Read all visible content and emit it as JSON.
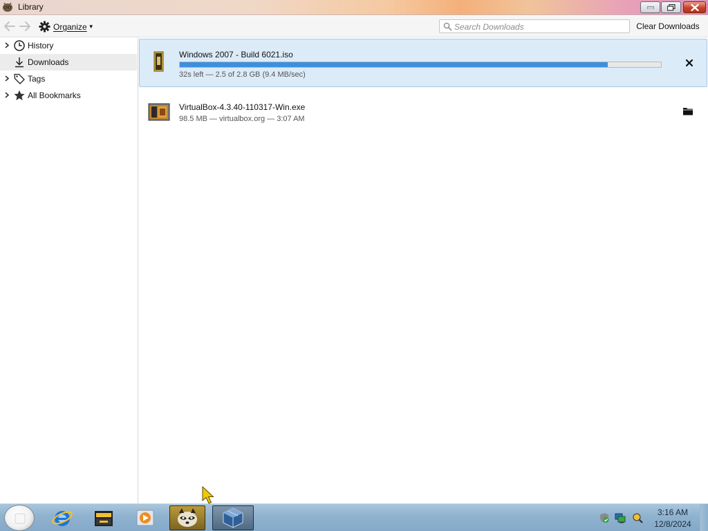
{
  "window": {
    "title": "Library",
    "app_icon": "raccoon-app-icon",
    "controls": [
      "minimize-icon",
      "maximize-icon",
      "close-icon"
    ]
  },
  "toolbar": {
    "back_icon": "back-arrow-icon",
    "forward_icon": "forward-arrow-icon",
    "organize_label": "Organize",
    "search_placeholder": "Search Downloads",
    "clear_label": "Clear Downloads"
  },
  "sidebar": {
    "items": [
      {
        "label": "History",
        "icon": "clock-icon",
        "expandable": true,
        "selected": false
      },
      {
        "label": "Downloads",
        "icon": "download-icon",
        "expandable": false,
        "selected": true
      },
      {
        "label": "Tags",
        "icon": "tag-icon",
        "expandable": true,
        "selected": false
      },
      {
        "label": "All Bookmarks",
        "icon": "star-icon",
        "expandable": true,
        "selected": false
      }
    ]
  },
  "downloads": [
    {
      "name": "Windows 2007 - Build 6021.iso",
      "status": "32s left — 2.5 of 2.8 GB (9.4 MB/sec)",
      "progress": 0.89,
      "action": "cancel",
      "active": true
    },
    {
      "name": "VirtualBox-4.3.40-110317-Win.exe",
      "status": "98.5 MB — virtualbox.org — 3:07 AM",
      "action": "open-folder",
      "active": false
    }
  ],
  "taskbar": {
    "apps": [
      "internet-explorer-icon",
      "file-manager-icon",
      "media-player-icon",
      "raccoon-browser-icon",
      "virtualbox-icon"
    ],
    "tray": [
      "security-shield-icon",
      "network-icon",
      "tray-app-icon"
    ],
    "time": "3:16 AM",
    "date": "12/8/2024"
  },
  "colors": {
    "accent": "#3d8fde",
    "selection": "#dcebf8",
    "taskbar": "#8fb2cf"
  }
}
